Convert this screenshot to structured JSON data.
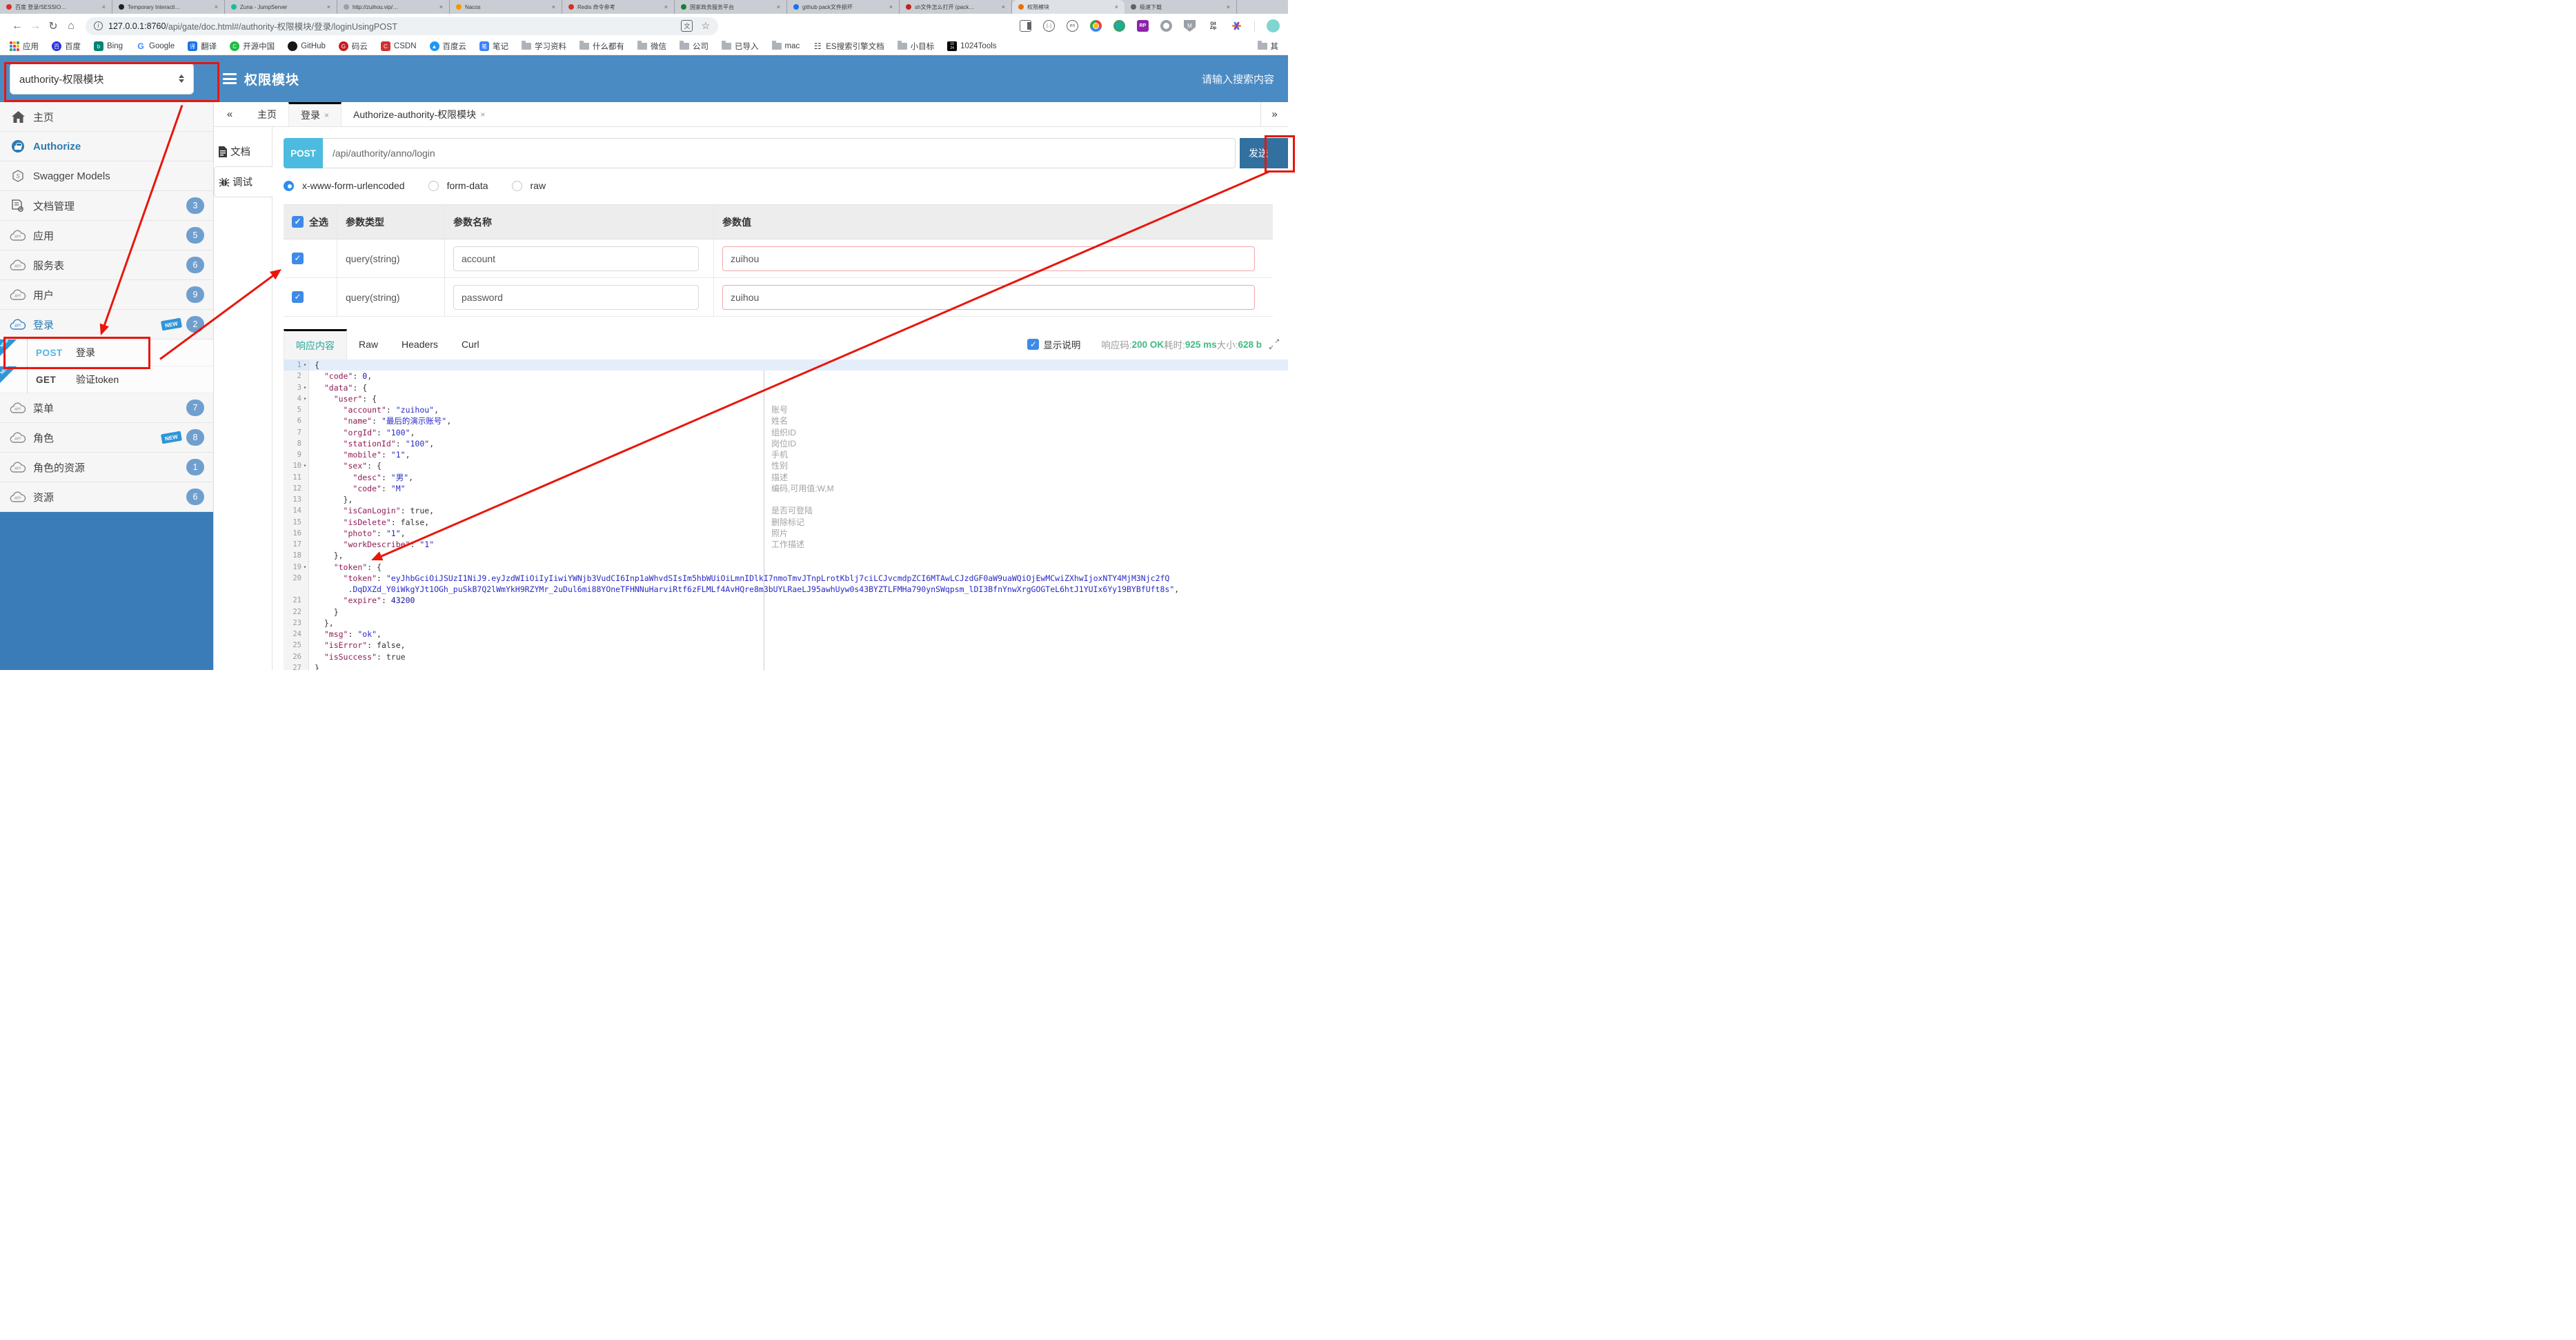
{
  "browser": {
    "tabs": [
      {
        "title": "百度 登录/SESSIO…",
        "color": "#d93025",
        "active": false
      },
      {
        "title": "Temporary Interacti…",
        "color": "#202124",
        "active": false
      },
      {
        "title": "Zuna - JumpServer",
        "color": "#1abc9c",
        "active": false
      },
      {
        "title": "http://zuihou.vip/…",
        "color": "#9aa0a6",
        "active": false
      },
      {
        "title": "Nacos",
        "color": "#f29900",
        "active": false
      },
      {
        "title": "Redis 命令参考",
        "color": "#d93025",
        "active": false
      },
      {
        "title": "国家政务服务平台",
        "color": "#188038",
        "active": false
      },
      {
        "title": "github pack文件损坏",
        "color": "#1a73e8",
        "active": false
      },
      {
        "title": "sh文件怎么打开 (pack…",
        "color": "#c5221f",
        "active": false
      },
      {
        "title": "权限模块",
        "color": "#e8710a",
        "active": true
      },
      {
        "title": "极速下载",
        "color": "#5f6368",
        "active": false
      }
    ],
    "url_host": "127.0.0.1:8760",
    "url_path": "/api/gate/doc.html#/authority-权限模块/登录/loginUsingPOST",
    "bookmarks": [
      {
        "label": "应用",
        "icon": "apps"
      },
      {
        "label": "百度",
        "icon": "circle",
        "color": "#2932e1",
        "letter": "百"
      },
      {
        "label": "Bing",
        "icon": "square",
        "color": "#008373",
        "letter": "b"
      },
      {
        "label": "Google",
        "icon": "google",
        "color": "#fff",
        "letter": "G"
      },
      {
        "label": "翻译",
        "icon": "square",
        "color": "#1a73e8",
        "letter": "译"
      },
      {
        "label": "开源中国",
        "icon": "circle",
        "color": "#21ba45",
        "letter": "C"
      },
      {
        "label": "GitHub",
        "icon": "circle",
        "color": "#181717",
        "letter": ""
      },
      {
        "label": "码云",
        "icon": "circle",
        "color": "#c71d23",
        "letter": "G"
      },
      {
        "label": "CSDN",
        "icon": "square",
        "color": "#d32f2f",
        "letter": "C"
      },
      {
        "label": "百度云",
        "icon": "circle",
        "color": "#2196f3",
        "letter": "▲"
      },
      {
        "label": "笔记",
        "icon": "square",
        "color": "#3b82f6",
        "letter": "笔"
      },
      {
        "label": "学习资料",
        "icon": "folder"
      },
      {
        "label": "什么都有",
        "icon": "folder"
      },
      {
        "label": "微信",
        "icon": "folder"
      },
      {
        "label": "公司",
        "icon": "folder"
      },
      {
        "label": "已导入",
        "icon": "folder"
      },
      {
        "label": "mac",
        "icon": "folder"
      },
      {
        "label": "ES搜索引擎文档",
        "icon": "book"
      },
      {
        "label": "小目标",
        "icon": "folder"
      },
      {
        "label": "1024Tools",
        "icon": "tools1024"
      }
    ],
    "bookmarks_overflow": {
      "label": "其",
      "icon": "folder"
    }
  },
  "header": {
    "module_select": "authority-权限模块",
    "title": "权限模块",
    "search_placeholder": "请输入搜索内容"
  },
  "sidebar": {
    "items": [
      {
        "icon": "home",
        "label": "主页"
      },
      {
        "icon": "lock",
        "label": "Authorize",
        "accent": true
      },
      {
        "icon": "models",
        "label": "Swagger Models"
      },
      {
        "icon": "docgear",
        "label": "文档管理",
        "badge": "3"
      },
      {
        "icon": "cloud",
        "label": "应用",
        "badge": "5"
      },
      {
        "icon": "cloud",
        "label": "服务表",
        "badge": "6"
      },
      {
        "icon": "cloud",
        "label": "用户",
        "badge": "9"
      },
      {
        "icon": "cloud",
        "label": "登录",
        "badge": "2",
        "new": true,
        "accent": true,
        "children": [
          {
            "method": "POST",
            "label": "登录",
            "new": true
          },
          {
            "method": "GET",
            "label": "验证token",
            "new": true
          }
        ]
      },
      {
        "icon": "cloud",
        "label": "菜单",
        "badge": "7"
      },
      {
        "icon": "cloud",
        "label": "角色",
        "badge": "8",
        "new": true
      },
      {
        "icon": "cloud",
        "label": "角色的资源",
        "badge": "1"
      },
      {
        "icon": "cloud",
        "label": "资源",
        "badge": "6"
      }
    ]
  },
  "doc_tabs": {
    "collapse": "«",
    "expand": "»",
    "items": [
      {
        "label": "主页",
        "closable": false,
        "active": false
      },
      {
        "label": "登录",
        "closable": true,
        "active": true
      },
      {
        "label": "Authorize-authority-权限模块",
        "closable": true,
        "active": false
      }
    ]
  },
  "mini_nav": {
    "doc": "文档",
    "debug": "调试"
  },
  "request": {
    "method": "POST",
    "url": "/api/authority/anno/login",
    "send_label": "发送",
    "content_types": [
      "x-www-form-urlencoded",
      "form-data",
      "raw"
    ],
    "selected_type": "x-www-form-urlencoded"
  },
  "param_table": {
    "headers": [
      "全选",
      "参数类型",
      "参数名称",
      "参数值"
    ],
    "rows": [
      {
        "checked": true,
        "type": "query(string)",
        "name": "account",
        "value": "zuihou"
      },
      {
        "checked": true,
        "type": "query(string)",
        "name": "password",
        "value": "zuihou"
      }
    ]
  },
  "response": {
    "tabs": [
      "响应内容",
      "Raw",
      "Headers",
      "Curl"
    ],
    "active_tab": "响应内容",
    "show_desc_label": "显示说明",
    "meta": [
      {
        "label": "响应码:",
        "value": "200 OK"
      },
      {
        "label": "耗时:",
        "value": "925 ms"
      },
      {
        "label": "大小:",
        "value": "628 b"
      }
    ]
  },
  "code": {
    "lines": [
      {
        "n": "1",
        "fold": true,
        "hl": true,
        "seg": [
          [
            "p",
            "{"
          ]
        ]
      },
      {
        "n": "2",
        "seg": [
          [
            "p",
            "  "
          ],
          [
            "k",
            "\"code\""
          ],
          [
            "p",
            ": "
          ],
          [
            "n",
            "0"
          ],
          [
            "p",
            ","
          ]
        ]
      },
      {
        "n": "3",
        "fold": true,
        "seg": [
          [
            "p",
            "  "
          ],
          [
            "k",
            "\"data\""
          ],
          [
            "p",
            ": {"
          ]
        ]
      },
      {
        "n": "4",
        "fold": true,
        "seg": [
          [
            "p",
            "    "
          ],
          [
            "k",
            "\"user\""
          ],
          [
            "p",
            ": {"
          ]
        ]
      },
      {
        "n": "5",
        "ann": "账号",
        "seg": [
          [
            "p",
            "      "
          ],
          [
            "k",
            "\"account\""
          ],
          [
            "p",
            ": "
          ],
          [
            "s",
            "\"zuihou\""
          ],
          [
            "p",
            ","
          ]
        ]
      },
      {
        "n": "6",
        "ann": "姓名",
        "seg": [
          [
            "p",
            "      "
          ],
          [
            "k",
            "\"name\""
          ],
          [
            "p",
            ": "
          ],
          [
            "s",
            "\"最后的演示账号\""
          ],
          [
            "p",
            ","
          ]
        ]
      },
      {
        "n": "7",
        "ann": "组织ID",
        "seg": [
          [
            "p",
            "      "
          ],
          [
            "k",
            "\"orgId\""
          ],
          [
            "p",
            ": "
          ],
          [
            "s",
            "\"100\""
          ],
          [
            "p",
            ","
          ]
        ]
      },
      {
        "n": "8",
        "ann": "岗位ID",
        "seg": [
          [
            "p",
            "      "
          ],
          [
            "k",
            "\"stationId\""
          ],
          [
            "p",
            ": "
          ],
          [
            "s",
            "\"100\""
          ],
          [
            "p",
            ","
          ]
        ]
      },
      {
        "n": "9",
        "ann": "手机",
        "seg": [
          [
            "p",
            "      "
          ],
          [
            "k",
            "\"mobile\""
          ],
          [
            "p",
            ": "
          ],
          [
            "s",
            "\"1\""
          ],
          [
            "p",
            ","
          ]
        ]
      },
      {
        "n": "10",
        "fold": true,
        "ann": "性别",
        "seg": [
          [
            "p",
            "      "
          ],
          [
            "k",
            "\"sex\""
          ],
          [
            "p",
            ": {"
          ]
        ]
      },
      {
        "n": "11",
        "ann": "描述",
        "seg": [
          [
            "p",
            "        "
          ],
          [
            "k",
            "\"desc\""
          ],
          [
            "p",
            ": "
          ],
          [
            "s",
            "\"男\""
          ],
          [
            "p",
            ","
          ]
        ]
      },
      {
        "n": "12",
        "ann": "编码,可用值:W,M",
        "seg": [
          [
            "p",
            "        "
          ],
          [
            "k",
            "\"code\""
          ],
          [
            "p",
            ": "
          ],
          [
            "s",
            "\"M\""
          ]
        ]
      },
      {
        "n": "13",
        "seg": [
          [
            "p",
            "      },"
          ]
        ]
      },
      {
        "n": "14",
        "ann": "是否可登陆",
        "seg": [
          [
            "p",
            "      "
          ],
          [
            "k",
            "\"isCanLogin\""
          ],
          [
            "p",
            ": true,"
          ]
        ]
      },
      {
        "n": "15",
        "ann": "删除标记",
        "seg": [
          [
            "p",
            "      "
          ],
          [
            "k",
            "\"isDelete\""
          ],
          [
            "p",
            ": false,"
          ]
        ]
      },
      {
        "n": "16",
        "ann": "照片",
        "seg": [
          [
            "p",
            "      "
          ],
          [
            "k",
            "\"photo\""
          ],
          [
            "p",
            ": "
          ],
          [
            "s",
            "\"1\""
          ],
          [
            "p",
            ","
          ]
        ]
      },
      {
        "n": "17",
        "ann": "工作描述",
        "seg": [
          [
            "p",
            "      "
          ],
          [
            "k",
            "\"workDescribe\""
          ],
          [
            "p",
            ": "
          ],
          [
            "s",
            "\"1\""
          ]
        ]
      },
      {
        "n": "18",
        "seg": [
          [
            "p",
            "    },"
          ]
        ]
      },
      {
        "n": "19",
        "fold": true,
        "seg": [
          [
            "p",
            "    "
          ],
          [
            "k",
            "\"token\""
          ],
          [
            "p",
            ": {"
          ]
        ]
      },
      {
        "n": "20",
        "seg": [
          [
            "p",
            "      "
          ],
          [
            "k",
            "\"token\""
          ],
          [
            "p",
            ": "
          ],
          [
            "s",
            "\"eyJhbGciOiJSUzI1NiJ9.eyJzdWIiOiIyIiwiYWNjb3VudCI6Inp1aWhvdSIsIm5hbWUiOiLmnIDlkI7nmoTmvJTnpLrotKblj7ciLCJvcmdpZCI6MTAwLCJzdGF0aW9uaWQiOjEwMCwiZXhwIjoxNTY4MjM3Njc2fQ"
          ]
        ]
      },
      {
        "n": "",
        "seg": [
          [
            "s",
            "       .DqDXZd_Y0iWkgYJt1OGh_puSkB7Q2lWmYkH9RZYMr_2uDul6mi88YOneTFHNNuHarviRtf6zFLMLf4AvHQre8m3bUYLRaeLJ95awhUyw0s43BYZTLFMHa790ynSWqpsm_lDI3BfnYnwXrgGOGTeL6htJ1YUIx6Yy19BYBfUft8s\""
          ],
          [
            "p",
            ","
          ]
        ]
      },
      {
        "n": "21",
        "seg": [
          [
            "p",
            "      "
          ],
          [
            "k",
            "\"expire\""
          ],
          [
            "p",
            ": "
          ],
          [
            "n",
            "43200"
          ]
        ]
      },
      {
        "n": "22",
        "seg": [
          [
            "p",
            "    }"
          ]
        ]
      },
      {
        "n": "23",
        "seg": [
          [
            "p",
            "  },"
          ]
        ]
      },
      {
        "n": "24",
        "seg": [
          [
            "p",
            "  "
          ],
          [
            "k",
            "\"msg\""
          ],
          [
            "p",
            ": "
          ],
          [
            "s",
            "\"ok\""
          ],
          [
            "p",
            ","
          ]
        ]
      },
      {
        "n": "25",
        "seg": [
          [
            "p",
            "  "
          ],
          [
            "k",
            "\"isError\""
          ],
          [
            "p",
            ": false,"
          ]
        ]
      },
      {
        "n": "26",
        "seg": [
          [
            "p",
            "  "
          ],
          [
            "k",
            "\"isSuccess\""
          ],
          [
            "p",
            ": true"
          ]
        ]
      },
      {
        "n": "27",
        "seg": [
          [
            "p",
            "}"
          ]
        ]
      }
    ]
  },
  "colors": {
    "header_blue": "#4b8bc4",
    "sidebar_footer_blue": "#3a7cb8",
    "post_badge": "#4cbbdf",
    "send_button": "#31709f",
    "annotation_red": "#e8160c",
    "meta_green": "#42b983",
    "json_key": "#8e1b56",
    "json_string": "#2929c8"
  }
}
